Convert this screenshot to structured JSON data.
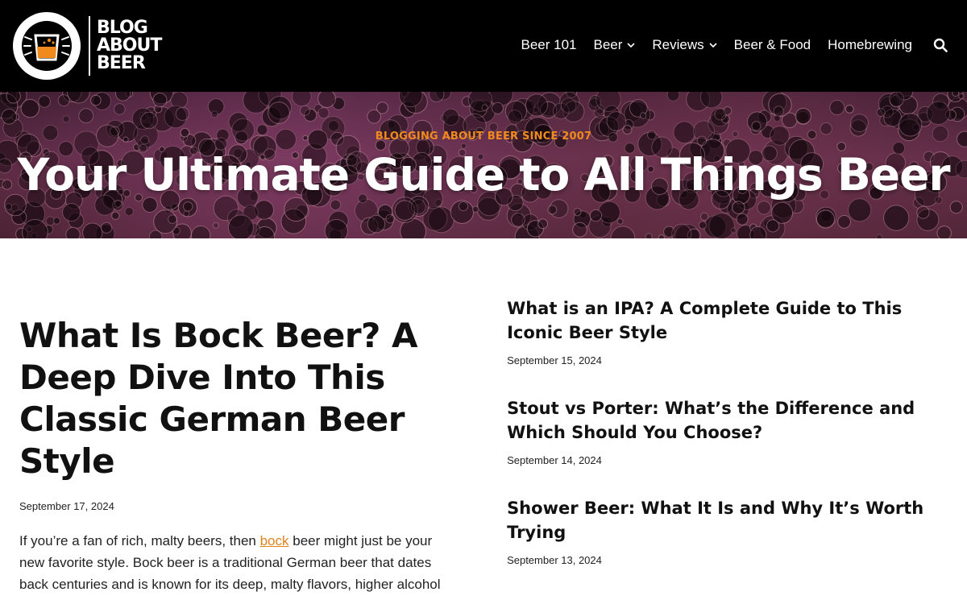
{
  "site": {
    "logo_lines": [
      "BLOG",
      "ABOUT",
      "BEER"
    ]
  },
  "nav": {
    "items": [
      {
        "label": "Beer 101",
        "has_dropdown": false
      },
      {
        "label": "Beer",
        "has_dropdown": true
      },
      {
        "label": "Reviews",
        "has_dropdown": true
      },
      {
        "label": "Beer & Food",
        "has_dropdown": false
      },
      {
        "label": "Homebrewing",
        "has_dropdown": false
      }
    ],
    "search_icon": "search-icon"
  },
  "hero": {
    "kicker": "BLOGGING ABOUT BEER SINCE 2007",
    "title": "Your Ultimate Guide to All Things Beer"
  },
  "featured": {
    "title": "What Is Bock Beer? A Deep Dive Into This Classic German Beer Style",
    "date": "September 17, 2024",
    "excerpt_before": "If you’re a fan of rich, malty beers, then ",
    "excerpt_link": "bock",
    "excerpt_after": " beer might just be your new favorite style. Bock beer is a traditional German beer that dates back centuries and is known for its deep, malty flavors, higher alcohol"
  },
  "sidebar_posts": [
    {
      "title": "What is an IPA? A Complete Guide to This Iconic Beer Style",
      "date": "September 15, 2024"
    },
    {
      "title": "Stout vs Porter: What’s the Difference and Which Should You Choose?",
      "date": "September 14, 2024"
    },
    {
      "title": "Shower Beer: What It Is and Why It’s Worth Trying",
      "date": "September 13, 2024"
    }
  ],
  "colors": {
    "header_bg": "#000000",
    "accent": "#f08a1c",
    "link": "#e0841a"
  }
}
